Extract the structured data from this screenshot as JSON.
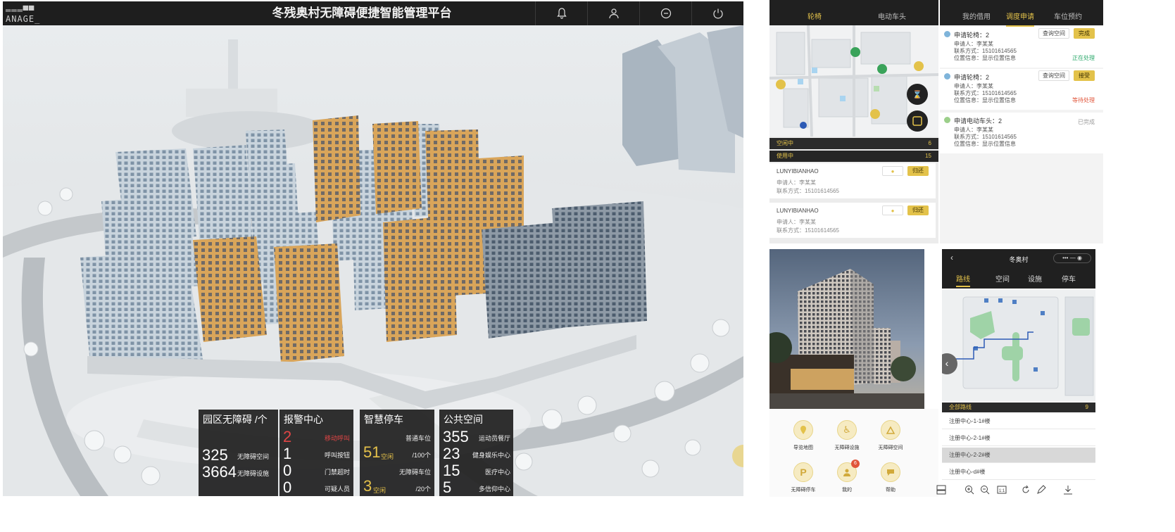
{
  "dashboard": {
    "logo_line1": "═══▀▀",
    "logo_line2": "ANAGE_",
    "title": "冬残奥村无障碍便捷智能管理平台",
    "top_icons": [
      "bell-icon",
      "user-icon",
      "minus-circle-icon",
      "power-icon"
    ],
    "panels": {
      "accessible": {
        "heading": "园区无障碍 /个",
        "rows": [
          {
            "value": "325",
            "label": "无障碍空间"
          },
          {
            "value": "3664",
            "label": "无障碍设施"
          }
        ]
      },
      "alarm": {
        "heading": "报警中心",
        "rows": [
          {
            "value": "2",
            "label": "移动呼叫"
          },
          {
            "value": "1",
            "label": "呼叫按钮"
          },
          {
            "value": "0",
            "label": "门禁超时"
          },
          {
            "value": "0",
            "label": "可疑人员"
          }
        ]
      },
      "parking": {
        "heading": "智慧停车",
        "rows": [
          {
            "label": "普通车位"
          },
          {
            "value": "51",
            "unit": "空闲",
            "total": "/100个"
          },
          {
            "label": "无障碍车位"
          },
          {
            "value": "3",
            "unit": "空闲",
            "total": "/20个"
          }
        ]
      },
      "public": {
        "heading": "公共空间",
        "rows": [
          {
            "value": "355",
            "label": "运动员餐厅"
          },
          {
            "value": "23",
            "label": "健身娱乐中心"
          },
          {
            "value": "15",
            "label": "医疗中心"
          },
          {
            "value": "5",
            "label": "多信仰中心"
          }
        ]
      }
    },
    "accent": "#e6c24a",
    "alarm_color": "#e04545"
  },
  "admin_list": {
    "tabs": [
      "轮椅",
      "电动车头"
    ],
    "idle": {
      "label": "空闲中",
      "count": "6"
    },
    "inuse": {
      "label": "使用中",
      "count": "15"
    },
    "cards": [
      {
        "code": "LUNYIBIANHAO",
        "applicant": "申请人：李某某",
        "contact": "联系方式：15101614565",
        "action": "归还"
      },
      {
        "code": "LUNYIBIANHAO",
        "applicant": "申请人：李某某",
        "contact": "联系方式：15101614565",
        "action": "归还"
      }
    ]
  },
  "requests": {
    "tabs": [
      "我的借用",
      "调度申请",
      "车位预约"
    ],
    "active_tab": "调度申请",
    "items": [
      {
        "title": "申请轮椅：2",
        "applicant": "申请人：李某某",
        "contact": "联系方式：15101614565",
        "location": "位置信息：显示位置信息",
        "view": "查询空间",
        "action": "完成",
        "status": "正在处理",
        "status_color": "#2aa86a"
      },
      {
        "title": "申请轮椅：2",
        "applicant": "申请人：李某某",
        "contact": "联系方式：15101614565",
        "location": "位置信息：显示位置信息",
        "view": "查询空间",
        "action": "接受",
        "status": "等待处理",
        "status_color": "#e0553a"
      },
      {
        "title": "申请电动车头：2",
        "applicant": "申请人：李某某",
        "contact": "联系方式：15101614565",
        "location": "位置信息：显示位置信息",
        "status": "已完成",
        "status_color": "#9a9a9a"
      }
    ]
  },
  "menu": {
    "items": [
      {
        "label": "导览地图",
        "icon": "map-pin-icon"
      },
      {
        "label": "无障碍设施",
        "icon": "wheelchair-icon"
      },
      {
        "label": "无障碍空间",
        "icon": "accessible-space-icon"
      },
      {
        "label": "无障碍停车",
        "icon": "parking-icon"
      },
      {
        "label": "我的",
        "icon": "profile-icon",
        "badge": "6"
      },
      {
        "label": "帮助",
        "icon": "chat-icon"
      }
    ]
  },
  "phone": {
    "title": "冬奥村",
    "tabs": [
      "路线",
      "空间",
      "设施",
      "停车"
    ],
    "active_tab": "路线",
    "list_header": {
      "label": "全部路线",
      "count": "9"
    },
    "routes": [
      "注册中心-1-1#楼",
      "注册中心-2-1#楼",
      "注册中心-2-2#楼",
      "注册中心-d#楼"
    ]
  },
  "toolbar_icons": [
    "layout-icon",
    "zoom-in-icon",
    "zoom-out-icon",
    "fit-icon",
    "rotate-icon",
    "pen-icon",
    "download-icon"
  ]
}
